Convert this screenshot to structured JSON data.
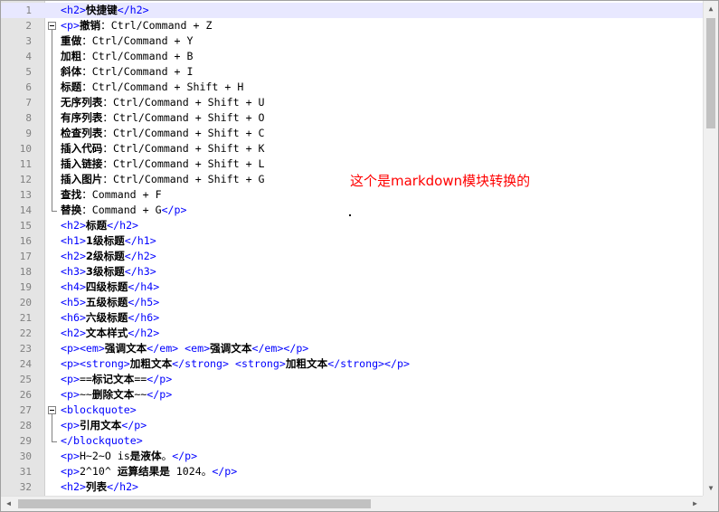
{
  "annotation": "这个是markdown模块转换的",
  "lines": [
    {
      "n": "1",
      "segs": [
        [
          "t",
          "<h2>"
        ],
        [
          "c",
          "快捷键"
        ],
        [
          "t",
          "</h2>"
        ]
      ]
    },
    {
      "n": "2",
      "segs": [
        [
          "t",
          "<p>"
        ],
        [
          "c",
          "撤销"
        ],
        [
          "x",
          "：Ctrl/Command + Z"
        ]
      ]
    },
    {
      "n": "3",
      "segs": [
        [
          "c",
          "重做"
        ],
        [
          "x",
          "：Ctrl/Command + Y"
        ]
      ]
    },
    {
      "n": "4",
      "segs": [
        [
          "c",
          "加粗"
        ],
        [
          "x",
          "：Ctrl/Command + B"
        ]
      ]
    },
    {
      "n": "5",
      "segs": [
        [
          "c",
          "斜体"
        ],
        [
          "x",
          "：Ctrl/Command + I"
        ]
      ]
    },
    {
      "n": "6",
      "segs": [
        [
          "c",
          "标题"
        ],
        [
          "x",
          "：Ctrl/Command + Shift + H"
        ]
      ]
    },
    {
      "n": "7",
      "segs": [
        [
          "c",
          "无序列表"
        ],
        [
          "x",
          "：Ctrl/Command + Shift + U"
        ]
      ]
    },
    {
      "n": "8",
      "segs": [
        [
          "c",
          "有序列表"
        ],
        [
          "x",
          "：Ctrl/Command + Shift + O"
        ]
      ]
    },
    {
      "n": "9",
      "segs": [
        [
          "c",
          "检查列表"
        ],
        [
          "x",
          "：Ctrl/Command + Shift + C"
        ]
      ]
    },
    {
      "n": "10",
      "segs": [
        [
          "c",
          "插入代码"
        ],
        [
          "x",
          "：Ctrl/Command + Shift + K"
        ]
      ]
    },
    {
      "n": "11",
      "segs": [
        [
          "c",
          "插入链接"
        ],
        [
          "x",
          "：Ctrl/Command + Shift + L"
        ]
      ]
    },
    {
      "n": "12",
      "segs": [
        [
          "c",
          "插入图片"
        ],
        [
          "x",
          "：Ctrl/Command + Shift + G"
        ]
      ]
    },
    {
      "n": "13",
      "segs": [
        [
          "c",
          "查找"
        ],
        [
          "x",
          "：Command + F"
        ]
      ]
    },
    {
      "n": "14",
      "segs": [
        [
          "c",
          "替换"
        ],
        [
          "x",
          "：Command + G"
        ],
        [
          "t",
          "</p>"
        ]
      ]
    },
    {
      "n": "15",
      "segs": [
        [
          "t",
          "<h2>"
        ],
        [
          "c",
          "标题"
        ],
        [
          "t",
          "</h2>"
        ]
      ]
    },
    {
      "n": "16",
      "segs": [
        [
          "t",
          "<h1>"
        ],
        [
          "c",
          "1级标题"
        ],
        [
          "t",
          "</h1>"
        ]
      ]
    },
    {
      "n": "17",
      "segs": [
        [
          "t",
          "<h2>"
        ],
        [
          "c",
          "2级标题"
        ],
        [
          "t",
          "</h2>"
        ]
      ]
    },
    {
      "n": "18",
      "segs": [
        [
          "t",
          "<h3>"
        ],
        [
          "c",
          "3级标题"
        ],
        [
          "t",
          "</h3>"
        ]
      ]
    },
    {
      "n": "19",
      "segs": [
        [
          "t",
          "<h4>"
        ],
        [
          "c",
          "四级标题"
        ],
        [
          "t",
          "</h4>"
        ]
      ]
    },
    {
      "n": "20",
      "segs": [
        [
          "t",
          "<h5>"
        ],
        [
          "c",
          "五级标题"
        ],
        [
          "t",
          "</h5>"
        ]
      ]
    },
    {
      "n": "21",
      "segs": [
        [
          "t",
          "<h6>"
        ],
        [
          "c",
          "六级标题"
        ],
        [
          "t",
          "</h6>"
        ]
      ]
    },
    {
      "n": "22",
      "segs": [
        [
          "t",
          "<h2>"
        ],
        [
          "c",
          "文本样式"
        ],
        [
          "t",
          "</h2>"
        ]
      ]
    },
    {
      "n": "23",
      "segs": [
        [
          "t",
          "<p><em>"
        ],
        [
          "c",
          "强调文本"
        ],
        [
          "t",
          "</em>"
        ],
        [
          "x",
          " "
        ],
        [
          "t",
          "<em>"
        ],
        [
          "c",
          "强调文本"
        ],
        [
          "t",
          "</em></p>"
        ]
      ]
    },
    {
      "n": "24",
      "segs": [
        [
          "t",
          "<p><strong>"
        ],
        [
          "c",
          "加粗文本"
        ],
        [
          "t",
          "</strong>"
        ],
        [
          "x",
          " "
        ],
        [
          "t",
          "<strong>"
        ],
        [
          "c",
          "加粗文本"
        ],
        [
          "t",
          "</strong></p>"
        ]
      ]
    },
    {
      "n": "25",
      "segs": [
        [
          "t",
          "<p>"
        ],
        [
          "x",
          "=="
        ],
        [
          "c",
          "标记文本"
        ],
        [
          "x",
          "=="
        ],
        [
          "t",
          "</p>"
        ]
      ]
    },
    {
      "n": "26",
      "segs": [
        [
          "t",
          "<p>"
        ],
        [
          "x",
          "~~"
        ],
        [
          "c",
          "删除文本"
        ],
        [
          "x",
          "~~"
        ],
        [
          "t",
          "</p>"
        ]
      ]
    },
    {
      "n": "27",
      "segs": [
        [
          "t",
          "<blockquote>"
        ]
      ]
    },
    {
      "n": "28",
      "segs": [
        [
          "t",
          "<p>"
        ],
        [
          "c",
          "引用文本"
        ],
        [
          "t",
          "</p>"
        ]
      ]
    },
    {
      "n": "29",
      "segs": [
        [
          "t",
          "</blockquote>"
        ]
      ]
    },
    {
      "n": "30",
      "segs": [
        [
          "t",
          "<p>"
        ],
        [
          "x",
          "H~2~O is"
        ],
        [
          "c",
          "是液体"
        ],
        [
          "x",
          "。"
        ],
        [
          "t",
          "</p>"
        ]
      ]
    },
    {
      "n": "31",
      "segs": [
        [
          "t",
          "<p>"
        ],
        [
          "x",
          "2^10^ "
        ],
        [
          "c",
          "运算结果是"
        ],
        [
          "x",
          " 1024。"
        ],
        [
          "t",
          "</p>"
        ]
      ]
    },
    {
      "n": "32",
      "segs": [
        [
          "t",
          "<h2>"
        ],
        [
          "c",
          "列表"
        ],
        [
          "t",
          "</h2>"
        ]
      ]
    }
  ]
}
